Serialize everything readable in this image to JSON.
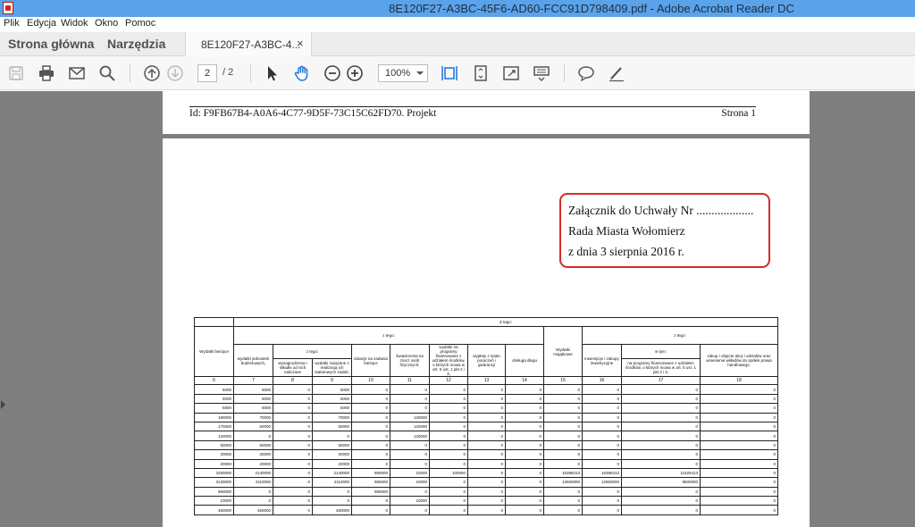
{
  "window": {
    "title": "8E120F27-A3BC-45F6-AD60-FCC91D798409.pdf - Adobe Acrobat Reader DC"
  },
  "menu": {
    "items": [
      "Plik",
      "Edycja",
      "Widok",
      "Okno",
      "Pomoc"
    ]
  },
  "tabs": {
    "home": "Strona główna",
    "tools": "Narzędzia",
    "document": "8E120F27-A3BC-4...",
    "close": "×"
  },
  "toolbar": {
    "page_current": "2",
    "page_total": "/ 2",
    "zoom": "100%",
    "icons": [
      "save-icon",
      "print-icon",
      "email-icon",
      "search-icon",
      "page-up-icon",
      "page-down-icon",
      "select-arrow-icon",
      "hand-tool-icon",
      "zoom-out-icon",
      "zoom-in-icon",
      "fit-width-icon",
      "fit-page-icon",
      "full-screen-icon",
      "read-mode-icon",
      "comment-icon",
      "sign-icon"
    ]
  },
  "page1": {
    "header_id": "Id: F9FB67B4-A0A6-4C77-9D5F-73C15C62FD70. Projekt",
    "header_page": "Strona 1"
  },
  "attachment": {
    "line1": "Załącznik do Uchwały Nr ...................",
    "line2": "Rada Miasta Wołomierz",
    "line3": "z dnia 3 sierpnia 2016 r."
  },
  "table": {
    "h_z_tego": "Z tego:",
    "h_bieżące": "Wydatki bieżące",
    "h_z_tego_2": "z tego:",
    "h_wydatki_jedn": "wydatki jednostek budżetowych,",
    "h_z_tego_3": "z tego:",
    "h_wynagrodzenia": "wynagrodzenia i składki od nich naliczane",
    "h_zadania_statut": "wydatki związane z realizacją ich statutowych zadań;",
    "h_dotacje": "dotacje na zadania bieżące",
    "h_świadczenia": "świadczenia na rzecz osób fizycznych;",
    "h_programy_ue": "wydatki na programy finansowane z udziałem środków, o których mowa w art. 5 ust. 1 pkt 2 i 3,",
    "h_poręczenia": "wypłaty z tytułu poręczeń i gwarancji",
    "h_obsługa_długu": "obsługa długu",
    "h_majątkowe": "Wydatki majątkowe",
    "h_z_tego_4": "z tego:",
    "h_inwestycje": "inwestycje i zakupy inwestycyjne",
    "h_w_tym": "w tym:",
    "h_inw_programy": "na programy finansowane z udziałem środków, o których mowa w art. 5 ust. 1 pkt 2 i 3,",
    "h_udziały": "zakup i objęcie akcji i udziałów oraz wniesienie wkładów do spółek prawa handlowego.",
    "col_numbers": [
      "6",
      "7",
      "8",
      "9",
      "10",
      "11",
      "12",
      "13",
      "14",
      "15",
      "16",
      "17",
      "18"
    ],
    "rows": [
      [
        "5000",
        "5000",
        "0",
        "5000",
        "0",
        "0",
        "0",
        "0",
        "0",
        "0",
        "0",
        "0",
        "0"
      ],
      [
        "5000",
        "5000",
        "0",
        "5000",
        "0",
        "0",
        "0",
        "0",
        "0",
        "0",
        "0",
        "0",
        "0"
      ],
      [
        "5000",
        "5000",
        "0",
        "5000",
        "0",
        "0",
        "0",
        "0",
        "0",
        "0",
        "0",
        "0",
        "0"
      ],
      [
        "190000",
        "70000",
        "0",
        "70000",
        "0",
        "120000",
        "0",
        "0",
        "0",
        "0",
        "0",
        "0",
        "0"
      ],
      [
        "170000",
        "50000",
        "0",
        "50000",
        "0",
        "120000",
        "0",
        "0",
        "0",
        "0",
        "0",
        "0",
        "0"
      ],
      [
        "120000",
        "0",
        "0",
        "0",
        "0",
        "120000",
        "0",
        "0",
        "0",
        "0",
        "0",
        "0",
        "0"
      ],
      [
        "50000",
        "50000",
        "0",
        "50000",
        "0",
        "0",
        "0",
        "0",
        "0",
        "0",
        "0",
        "0",
        "0"
      ],
      [
        "20000",
        "20000",
        "0",
        "20000",
        "0",
        "0",
        "0",
        "0",
        "0",
        "0",
        "0",
        "0",
        "0"
      ],
      [
        "20000",
        "20000",
        "0",
        "20000",
        "0",
        "0",
        "0",
        "0",
        "0",
        "0",
        "0",
        "0",
        "0"
      ],
      [
        "3250000",
        "2140000",
        "0",
        "2140000",
        "960000",
        "10000",
        "100000",
        "0",
        "0",
        "15388413",
        "15388413",
        "11525413",
        "0"
      ],
      [
        "3130000",
        "2110000",
        "0",
        "2110000",
        "960000",
        "10000",
        "0",
        "0",
        "0",
        "12650000",
        "12650000",
        "9500000",
        "0"
      ],
      [
        "960000",
        "0",
        "0",
        "0",
        "960000",
        "0",
        "0",
        "0",
        "0",
        "0",
        "0",
        "0",
        "0"
      ],
      [
        "10000",
        "0",
        "0",
        "0",
        "0",
        "10000",
        "0",
        "0",
        "0",
        "0",
        "0",
        "0",
        "0"
      ],
      [
        "460000",
        "460000",
        "0",
        "460000",
        "0",
        "0",
        "0",
        "0",
        "0",
        "0",
        "0",
        "0",
        "0"
      ]
    ]
  }
}
